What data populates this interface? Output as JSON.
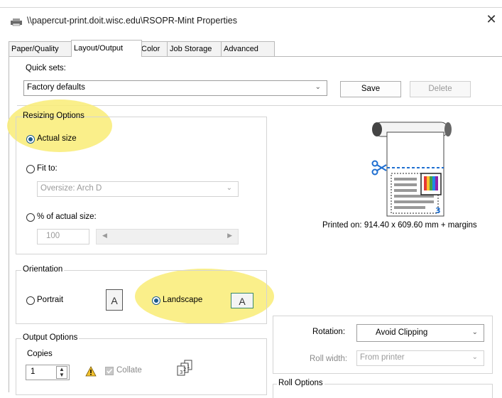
{
  "window": {
    "title": "\\\\papercut-print.doit.wisc.edu\\RSOPR-Mint Properties",
    "close_glyph": "✕"
  },
  "tabs": [
    {
      "label": "Paper/Quality",
      "active": false
    },
    {
      "label": "Layout/Output",
      "active": true
    },
    {
      "label": "Color",
      "active": false
    },
    {
      "label": "Job Storage",
      "active": false
    },
    {
      "label": "Advanced",
      "active": false
    }
  ],
  "quick_sets": {
    "label": "Quick sets:",
    "value": "Factory defaults",
    "save_label": "Save",
    "delete_label": "Delete"
  },
  "resizing": {
    "title": "Resizing Options",
    "actual_size_label": "Actual size",
    "fit_to_label": "Fit to:",
    "fit_to_value": "Oversize: Arch D",
    "percent_label": "% of actual size:",
    "percent_value": "100",
    "selected": "actual_size"
  },
  "preview": {
    "printed_on": "Printed on: 914.40 x 609.60 mm + margins"
  },
  "orientation": {
    "title": "Orientation",
    "portrait_label": "Portrait",
    "landscape_label": "Landscape",
    "page_glyph": "A",
    "selected": "landscape"
  },
  "rotation": {
    "label": "Rotation:",
    "value": "Avoid Clipping",
    "roll_width_label": "Roll width:",
    "roll_width_value": "From printer"
  },
  "output": {
    "title": "Output Options",
    "copies_label": "Copies",
    "copies_value": "1",
    "collate_label": "Collate"
  },
  "roll_options": {
    "title": "Roll Options"
  },
  "colors": {
    "accent": "#1a5a8c",
    "highlight": "#f9ec76",
    "cut_line": "#1f6fd1"
  }
}
